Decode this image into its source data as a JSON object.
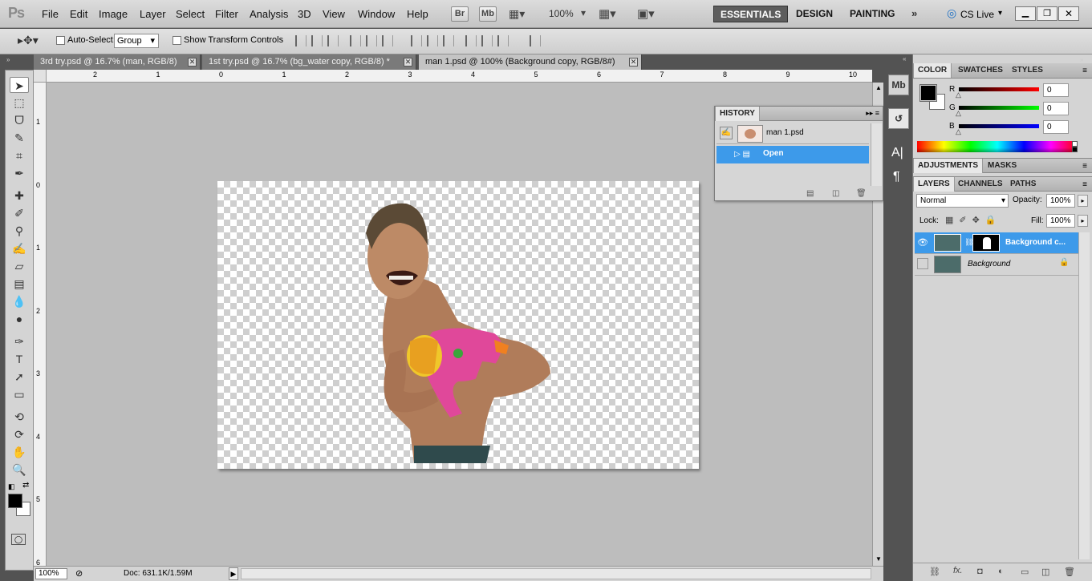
{
  "app": {
    "logo": "Ps"
  },
  "menu": [
    "File",
    "Edit",
    "Image",
    "Layer",
    "Select",
    "Filter",
    "Analysis",
    "3D",
    "View",
    "Window",
    "Help"
  ],
  "appbar": {
    "bridge_btn": "Br",
    "minibridge_btn": "Mb",
    "zoom": "100%"
  },
  "workspaces": [
    "ESSENTIALS",
    "DESIGN",
    "PAINTING"
  ],
  "cs_live": "CS Live",
  "options": {
    "auto_select_label": "Auto-Select:",
    "auto_select_value": "Group",
    "show_transform_label": "Show Transform Controls"
  },
  "tabs": [
    {
      "label": "3rd try.psd @ 16.7% (man, RGB/8)",
      "active": false
    },
    {
      "label": "1st try.psd @ 16.7% (bg_water copy, RGB/8) *",
      "active": false
    },
    {
      "label": "man 1.psd @ 100% (Background copy, RGB/8#)",
      "active": true
    }
  ],
  "ruler": {
    "top": [
      "2",
      "1",
      "0",
      "1",
      "2",
      "3",
      "4",
      "5",
      "6",
      "7",
      "8",
      "9",
      "10"
    ],
    "left": [
      "1",
      "0",
      "1",
      "2",
      "3",
      "4",
      "5",
      "6"
    ]
  },
  "status": {
    "zoom": "100%",
    "doc": "Doc: 631.1K/1.59M"
  },
  "history": {
    "title": "HISTORY",
    "snapshot": "man 1.psd",
    "step": "Open"
  },
  "color": {
    "tabs": [
      "COLOR",
      "SWATCHES",
      "STYLES"
    ],
    "r_label": "R",
    "g_label": "G",
    "b_label": "B",
    "r": "0",
    "g": "0",
    "b": "0",
    "fg": "#000000",
    "bg": "#ffffff"
  },
  "adjustments": {
    "tabs": [
      "ADJUSTMENTS",
      "MASKS"
    ]
  },
  "layers_panel": {
    "tabs": [
      "LAYERS",
      "CHANNELS",
      "PATHS"
    ],
    "blend": "Normal",
    "opacity_label": "Opacity:",
    "opacity": "100%",
    "lock_label": "Lock:",
    "fill_label": "Fill:",
    "fill": "100%",
    "layers": [
      {
        "name": "Background c...",
        "selected": true,
        "visible": true
      },
      {
        "name": "Background",
        "selected": false,
        "visible": false,
        "locked": true
      }
    ]
  },
  "colors": {
    "accent": "#3d9aea",
    "panel": "#d4d4d4",
    "workspace": "#bdbdbd"
  }
}
